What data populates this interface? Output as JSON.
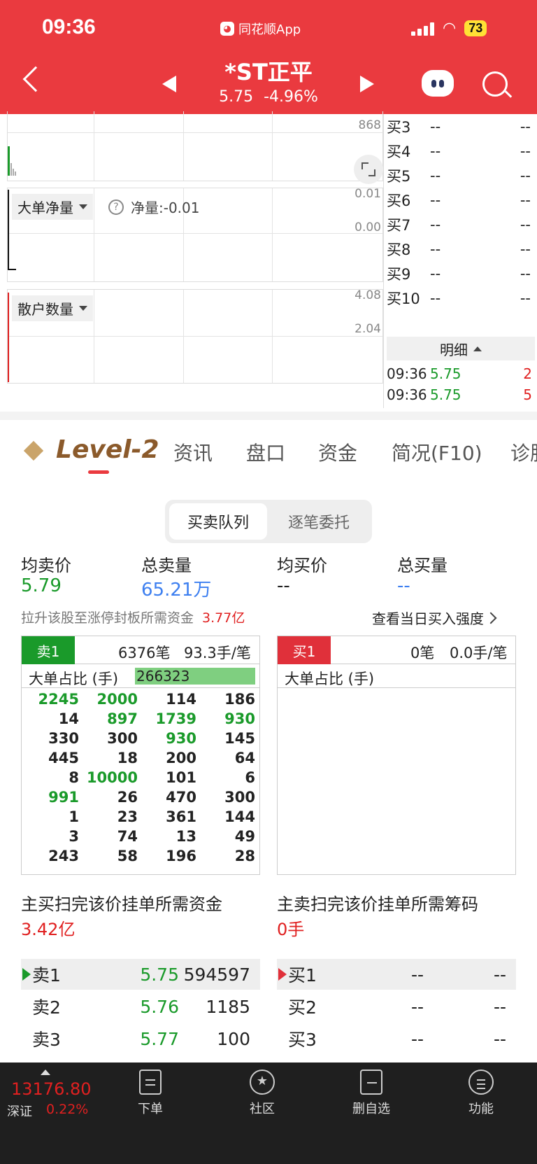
{
  "status_bar": {
    "time": "09:36",
    "app_name": "同花顺App",
    "battery": "73"
  },
  "header": {
    "stock_name": "*ST正平",
    "price": "5.75",
    "change_pct": "-4.96%"
  },
  "chart": {
    "volume_axis_label": "868",
    "net_panel": {
      "selector": "大单净量",
      "net_label": "净量:-0.01",
      "axis_top": "0.01",
      "axis_mid": "0.00"
    },
    "retail_panel": {
      "selector": "散户数量",
      "axis_top": "4.08",
      "axis_mid": "2.04"
    }
  },
  "book_right": {
    "rows": [
      {
        "label": "买3",
        "price": "--",
        "volume": "--"
      },
      {
        "label": "买4",
        "price": "--",
        "volume": "--"
      },
      {
        "label": "买5",
        "price": "--",
        "volume": "--"
      },
      {
        "label": "买6",
        "price": "--",
        "volume": "--"
      },
      {
        "label": "买7",
        "price": "--",
        "volume": "--"
      },
      {
        "label": "买8",
        "price": "--",
        "volume": "--"
      },
      {
        "label": "买9",
        "price": "--",
        "volume": "--"
      },
      {
        "label": "买10",
        "price": "--",
        "volume": "--"
      }
    ],
    "detail_label": "明细",
    "trades": [
      {
        "time": "09:36",
        "price": "5.75",
        "volume": "2"
      },
      {
        "time": "09:36",
        "price": "5.75",
        "volume": "5"
      }
    ]
  },
  "tabs": {
    "level2": "Level-2",
    "items": [
      "资讯",
      "盘口",
      "资金",
      "简况(F10)",
      "诊股"
    ]
  },
  "segment": {
    "active": "买卖队列",
    "other": "逐笔委托"
  },
  "summary": {
    "avg_sell_label": "均卖价",
    "avg_sell": "5.79",
    "total_sell_label": "总卖量",
    "total_sell": "65.21万",
    "avg_buy_label": "均买价",
    "avg_buy": "--",
    "total_buy_label": "总买量",
    "total_buy": "--",
    "limit_note": "拉升该股至涨停封板所需资金",
    "limit_value": "3.77亿",
    "view_link": "查看当日买入强度"
  },
  "sell_queue": {
    "badge": "卖1",
    "count": "6376笔",
    "per": "93.3手/笔",
    "ratio_label": "大单占比 (手)",
    "ratio_value": "266323",
    "rows": [
      [
        {
          "v": "2245",
          "c": "g"
        },
        {
          "v": "2000",
          "c": "g"
        },
        {
          "v": "114",
          "c": "k"
        },
        {
          "v": "186",
          "c": "k"
        }
      ],
      [
        {
          "v": "14",
          "c": "k"
        },
        {
          "v": "897",
          "c": "g"
        },
        {
          "v": "1739",
          "c": "g"
        },
        {
          "v": "930",
          "c": "g"
        }
      ],
      [
        {
          "v": "330",
          "c": "k"
        },
        {
          "v": "300",
          "c": "k"
        },
        {
          "v": "930",
          "c": "g"
        },
        {
          "v": "145",
          "c": "k"
        }
      ],
      [
        {
          "v": "445",
          "c": "k"
        },
        {
          "v": "18",
          "c": "k"
        },
        {
          "v": "200",
          "c": "k"
        },
        {
          "v": "64",
          "c": "k"
        }
      ],
      [
        {
          "v": "8",
          "c": "k"
        },
        {
          "v": "10000",
          "c": "g"
        },
        {
          "v": "101",
          "c": "k"
        },
        {
          "v": "6",
          "c": "k"
        }
      ],
      [
        {
          "v": "991",
          "c": "g"
        },
        {
          "v": "26",
          "c": "k"
        },
        {
          "v": "470",
          "c": "k"
        },
        {
          "v": "300",
          "c": "k"
        }
      ],
      [
        {
          "v": "1",
          "c": "k"
        },
        {
          "v": "23",
          "c": "k"
        },
        {
          "v": "361",
          "c": "k"
        },
        {
          "v": "144",
          "c": "k"
        }
      ],
      [
        {
          "v": "3",
          "c": "k"
        },
        {
          "v": "74",
          "c": "k"
        },
        {
          "v": "13",
          "c": "k"
        },
        {
          "v": "49",
          "c": "k"
        }
      ],
      [
        {
          "v": "243",
          "c": "k"
        },
        {
          "v": "58",
          "c": "k"
        },
        {
          "v": "196",
          "c": "k"
        },
        {
          "v": "28",
          "c": "k"
        }
      ]
    ]
  },
  "buy_queue": {
    "badge": "买1",
    "count": "0笔",
    "per": "0.0手/笔",
    "ratio_label": "大单占比 (手)"
  },
  "sweep": {
    "buy_title": "主买扫完该价挂单所需资金",
    "buy_value": "3.42亿",
    "sell_title": "主卖扫完该价挂单所需筹码",
    "sell_value": "0手"
  },
  "order_book": {
    "sell": [
      {
        "label": "卖1",
        "price": "5.75",
        "volume": "594597"
      },
      {
        "label": "卖2",
        "price": "5.76",
        "volume": "1185"
      },
      {
        "label": "卖3",
        "price": "5.77",
        "volume": "100"
      }
    ],
    "buy": [
      {
        "label": "买1",
        "price": "--",
        "volume": "--"
      },
      {
        "label": "买2",
        "price": "--",
        "volume": "--"
      },
      {
        "label": "买3",
        "price": "--",
        "volume": "--"
      }
    ]
  },
  "bottom_nav": {
    "index_value": "13176.80",
    "index_name": "深证",
    "index_change": "0.22%",
    "items": [
      "下单",
      "社区",
      "删自选",
      "功能"
    ]
  },
  "colors": {
    "brand_red": "#ea3a3f",
    "up": "#e02020",
    "down": "#1a9a2a",
    "accent_blue": "#3d7ff0",
    "level2_gold": "#8b5a2b"
  }
}
